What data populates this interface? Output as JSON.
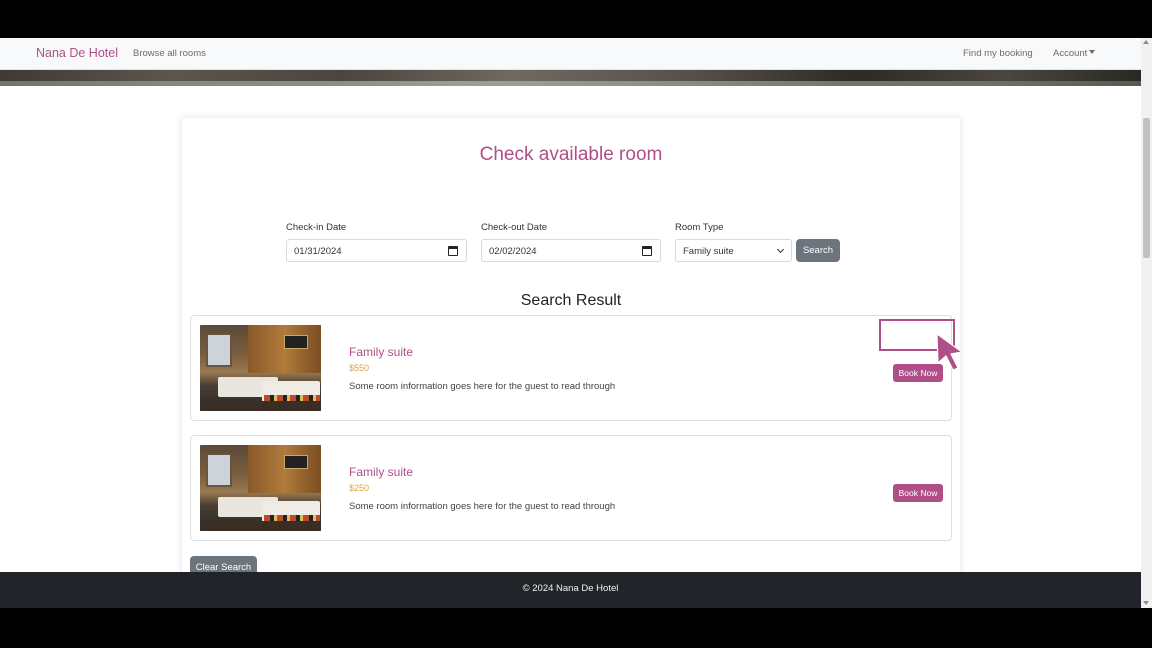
{
  "navbar": {
    "brand": "Nana De Hotel",
    "browse_link": "Browse all rooms",
    "find_booking_link": "Find my booking",
    "account_menu": "Account"
  },
  "search_form": {
    "title": "Check available room",
    "checkin_label": "Check-in Date",
    "checkin_value": "01/31/2024",
    "checkout_label": "Check-out Date",
    "checkout_value": "02/02/2024",
    "room_type_label": "Room Type",
    "room_type_value": "Family suite",
    "search_button": "Search"
  },
  "results": {
    "heading": "Search Result",
    "items": [
      {
        "name": "Family suite",
        "price": "$550",
        "description": "Some room information goes here for the guest to read through",
        "book_label": "Book Now"
      },
      {
        "name": "Family suite",
        "price": "$250",
        "description": "Some room information goes here for the guest to read through",
        "book_label": "Book Now"
      }
    ],
    "clear_button": "Clear Search"
  },
  "footer": {
    "text": "© 2024 Nana De Hotel"
  },
  "icons": {
    "calendar": "calendar-icon",
    "chevron": "chevron-down-icon",
    "cursor": "pointer-cursor-icon"
  },
  "colors": {
    "accent": "#b04f87",
    "price": "#d9a441",
    "secondary_button": "#6c757d",
    "footer_bg": "#212529"
  }
}
